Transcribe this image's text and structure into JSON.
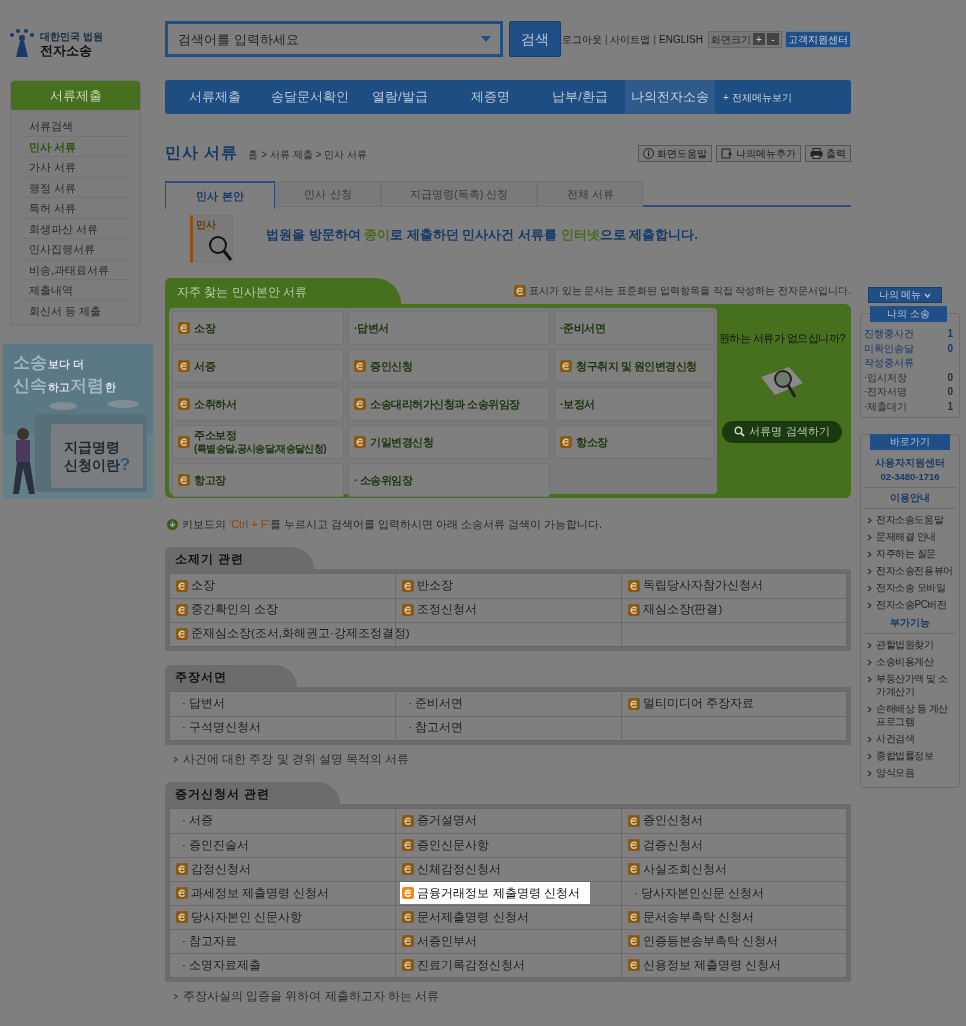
{
  "header": {
    "logo_caption": "대한민국 법원",
    "logo_title": "전자소송",
    "search": {
      "placeholder": "검색어를 입력하세요"
    },
    "search_button": "검색",
    "links": [
      "로그아웃",
      "사이트맵",
      "ENGLISH"
    ],
    "separator": "|",
    "zoom_label": "화면크기",
    "zoom_buttons": [
      "+",
      "-"
    ],
    "support_button": "고객지원센터"
  },
  "sidebar": {
    "title": "서류제출",
    "items": [
      {
        "label": "서류검색",
        "selected": false
      },
      {
        "label": "민사 서류",
        "selected": true
      },
      {
        "label": "가사 서류",
        "selected": false
      },
      {
        "label": "행정 서류",
        "selected": false
      },
      {
        "label": "특허 서류",
        "selected": false
      },
      {
        "label": "회생파산 서류",
        "selected": false
      },
      {
        "label": "민사집행서류",
        "selected": false
      },
      {
        "label": "비송,과태료서류",
        "selected": false
      },
      {
        "label": "제출내역",
        "selected": false
      },
      {
        "label": "회신서 등 제출",
        "selected": false
      }
    ]
  },
  "banner": {
    "line1": [
      {
        "text": "소송",
        "big": true
      },
      {
        "text": "보다 더",
        "big": false
      }
    ],
    "line2": [
      {
        "text": "신속",
        "big": true
      },
      {
        "text": "하고",
        "big": false
      },
      {
        "text": "저렴",
        "big": true
      },
      {
        "text": "한",
        "big": false
      }
    ],
    "card_lines": [
      "지급명령",
      "신청이란"
    ],
    "mark": "?"
  },
  "nav": {
    "items": [
      {
        "label": "서류제출",
        "selected": false
      },
      {
        "label": "송달문서확인",
        "selected": false
      },
      {
        "label": "열람/발급",
        "selected": false
      },
      {
        "label": "제증명",
        "selected": false
      },
      {
        "label": "납부/환급",
        "selected": false
      },
      {
        "label": "나의전자소송",
        "selected": true
      }
    ],
    "all_menu": "+ 전체메뉴보기"
  },
  "page_title": "민사 서류",
  "breadcrumb": "홈 > 서류 제출 > 민사 서류",
  "tools": [
    {
      "label": "화면도움말",
      "kind": "help"
    },
    {
      "label": "나의메뉴추가",
      "kind": "add"
    },
    {
      "label": "출력",
      "kind": "print"
    }
  ],
  "tabs": [
    {
      "label": "민사 본안",
      "selected": true
    },
    {
      "label": "민사 신청",
      "selected": false
    },
    {
      "label": "지급명령(독촉) 신청",
      "selected": false
    },
    {
      "label": "전체 서류",
      "selected": false
    }
  ],
  "intro": {
    "icon_text": "민사",
    "segments": [
      {
        "text": "법원을 방문하여 ",
        "accent": false
      },
      {
        "text": "종이",
        "accent": true
      },
      {
        "text": "로 제출하던 민사사건 서류를 ",
        "accent": false
      },
      {
        "text": "인터넷",
        "accent": true
      },
      {
        "text": "으로 제출합니다.",
        "accent": false
      }
    ]
  },
  "frequent": {
    "title": "자주 찾는 민사본안 서류",
    "note": "표시가 있는 문서는 표준화된 입력항목을 직접 작성하는 전자문서입니다.",
    "items": [
      {
        "label": "소장",
        "kind": "form"
      },
      {
        "label": "·답변서",
        "kind": "plain"
      },
      {
        "label": "·준비서면",
        "kind": "plain"
      },
      {
        "label": "서증",
        "kind": "form"
      },
      {
        "label": "증인신청",
        "kind": "form"
      },
      {
        "label": "청구취지 및 원인변경신청",
        "kind": "form"
      },
      {
        "label": "소취하서",
        "kind": "form"
      },
      {
        "label": "소송대리허가신청과 소송위임장",
        "kind": "form"
      },
      {
        "label": "·보정서",
        "kind": "plain"
      },
      {
        "label": "주소보정",
        "sub": "(특별송달,공시송달,재송달신청)",
        "kind": "form"
      },
      {
        "label": "기일변경신청",
        "kind": "form"
      },
      {
        "label": "항소장",
        "kind": "form"
      },
      {
        "label": "항고장",
        "kind": "form"
      },
      {
        "label": "· 소송위임장",
        "kind": "plain"
      }
    ],
    "question": "원하는 서류가 없으십니까?",
    "search_button": "서류명 검색하기"
  },
  "tip": [
    {
      "text": "키보드의 ",
      "accent": false
    },
    {
      "text": "'Ctrl + F'",
      "accent": true
    },
    {
      "text": "를 누르시고 검색어를 입력하시면 아래 소송서류 검색이 가능합니다.",
      "accent": false
    }
  ],
  "sections": [
    {
      "title": "소제기 관련",
      "items": [
        {
          "label": "소장",
          "kind": "form",
          "highlighted": false
        },
        {
          "label": "반소장",
          "kind": "form",
          "highlighted": false
        },
        {
          "label": "독립당사자참가신청서",
          "kind": "form",
          "highlighted": false
        },
        {
          "label": "중간확인의 소장",
          "kind": "form",
          "highlighted": false
        },
        {
          "label": "조정신청서",
          "kind": "form",
          "highlighted": false
        },
        {
          "label": "재심소장(판결)",
          "kind": "form",
          "highlighted": false
        },
        {
          "label": "준재심소장(조서,화해권고·강제조정결정)",
          "kind": "form",
          "highlighted": false
        }
      ]
    },
    {
      "title": "주장서면",
      "items": [
        {
          "label": "· 답변서",
          "kind": "plain",
          "highlighted": false
        },
        {
          "label": "· 준비서면",
          "kind": "plain",
          "highlighted": false
        },
        {
          "label": "멀티미디어 주장자료",
          "kind": "form",
          "highlighted": false
        },
        {
          "label": "· 구석명신청서",
          "kind": "plain",
          "highlighted": false
        },
        {
          "label": "· 참고서면",
          "kind": "plain",
          "highlighted": false
        }
      ],
      "footnote": "사건에 대한 주장 및 경위 설명 목적의 서류"
    },
    {
      "title": "증거신청서 관련",
      "items": [
        {
          "label": "· 서증",
          "kind": "plain",
          "highlighted": false
        },
        {
          "label": "증거설명서",
          "kind": "form",
          "highlighted": false
        },
        {
          "label": "증인신청서",
          "kind": "form",
          "highlighted": false
        },
        {
          "label": "· 증인진술서",
          "kind": "plain",
          "highlighted": false
        },
        {
          "label": "증인신문사항",
          "kind": "form",
          "highlighted": false
        },
        {
          "label": "검증신청서",
          "kind": "form",
          "highlighted": false
        },
        {
          "label": "감정신청서",
          "kind": "form",
          "highlighted": false
        },
        {
          "label": "신체감정신청서",
          "kind": "form",
          "highlighted": false
        },
        {
          "label": "사실조회신청서",
          "kind": "form",
          "highlighted": false
        },
        {
          "label": "과세정보 제출명령 신청서",
          "kind": "form",
          "highlighted": false
        },
        {
          "label": "금융거래정보 제출명령 신청서",
          "kind": "form",
          "highlighted": true
        },
        {
          "label": "· 당사자본인신문 신청서",
          "kind": "plain",
          "highlighted": false
        },
        {
          "label": "당사자본인 신문사항",
          "kind": "form",
          "highlighted": false
        },
        {
          "label": "문서제출명령 신청서",
          "kind": "form",
          "highlighted": false
        },
        {
          "label": "문서송부촉탁 신청서",
          "kind": "form",
          "highlighted": false
        },
        {
          "label": "· 참고자료",
          "kind": "plain",
          "highlighted": false
        },
        {
          "label": "서증인부서",
          "kind": "form",
          "highlighted": false
        },
        {
          "label": "인증등본송부촉탁 신청서",
          "kind": "form",
          "highlighted": false
        },
        {
          "label": "· 소명자료제출",
          "kind": "plain",
          "highlighted": false
        },
        {
          "label": "진료기록감정신청서",
          "kind": "form",
          "highlighted": false
        },
        {
          "label": "신용정보 제출명령 신청서",
          "kind": "form",
          "highlighted": false
        }
      ],
      "footnote": "주장사실의 입증을 위하여 제출하고자 하는 서류"
    }
  ],
  "right": {
    "my_menu": "나의 메뉴",
    "my_case": {
      "title": "나의 소송",
      "rows": [
        {
          "label": "진행중사건",
          "value": "1",
          "kind": "main"
        },
        {
          "label": "미확인송달",
          "value": "0",
          "kind": "main"
        },
        {
          "label": "작성중서류",
          "kind": "main"
        },
        {
          "label": "·임시저장",
          "value": "0",
          "kind": "sub"
        },
        {
          "label": "·전자서명",
          "value": "0",
          "kind": "sub"
        },
        {
          "label": "·제출대기",
          "value": "1",
          "kind": "sub"
        }
      ]
    },
    "shortcuts": {
      "title": "바로가기",
      "center": "사용자지원센터",
      "phone": "02-3480-1716",
      "groups": [
        {
          "title": "이용안내",
          "links": [
            "전자소송도움말",
            "문제해결 안내",
            "자주하는 질문",
            "전자소송전용뷰어",
            "전자소송 모바일",
            "전자소송PC버전"
          ]
        },
        {
          "title": "부가기능",
          "links": [
            "관할법원찾기",
            "소송비용계산",
            "부동산가액 및 소가계산기",
            "손해배상 등 계산 프로그램",
            "사건검색",
            "종합법률정보",
            "양식모음"
          ]
        }
      ]
    }
  }
}
